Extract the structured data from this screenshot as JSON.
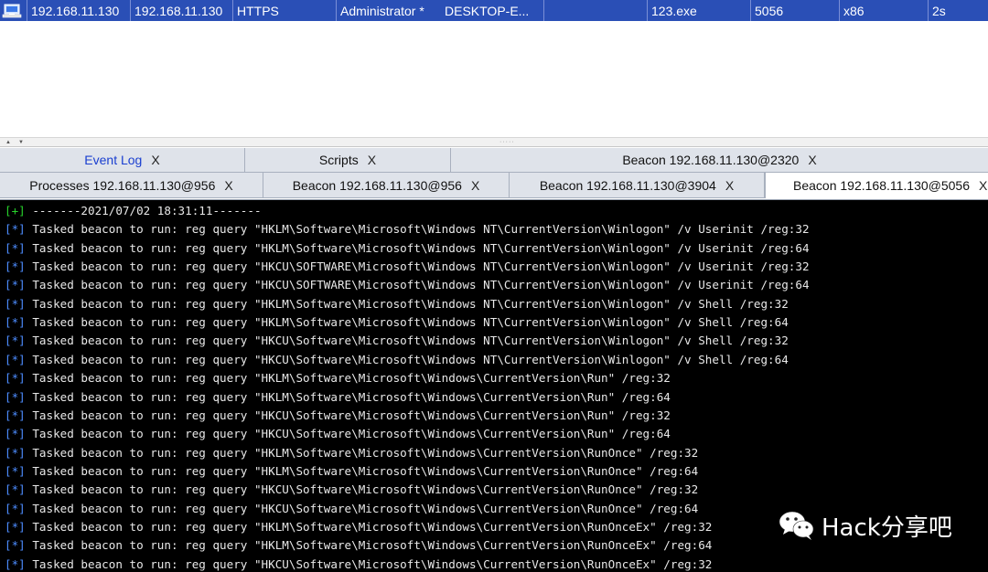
{
  "sessions": {
    "rows": [
      {
        "external": "192.168.11.130",
        "internal": "192.168.11.130",
        "listener": "HTTPS",
        "user": "Administrator *",
        "computer": "DESKTOP-E...",
        "note": "",
        "process": "123.exe",
        "pid": "5056",
        "arch": "x86",
        "last": "2s"
      }
    ],
    "icon": "beacon-computer-icon"
  },
  "splitter": {
    "up": "▲",
    "down": "▼",
    "grip": "·····"
  },
  "tabs_row1": [
    {
      "label": "Event Log",
      "close": "X",
      "active": false
    },
    {
      "label": "Scripts",
      "close": "X",
      "active": false
    },
    {
      "label": "Beacon 192.168.11.130@2320",
      "close": "X",
      "active": false
    }
  ],
  "tabs_row2": [
    {
      "label": "Processes 192.168.11.130@956",
      "close": "X",
      "active": false
    },
    {
      "label": "Beacon 192.168.11.130@956",
      "close": "X",
      "active": false
    },
    {
      "label": "Beacon 192.168.11.130@3904",
      "close": "X",
      "active": false
    },
    {
      "label": "Beacon 192.168.11.130@5056",
      "close": "X",
      "active": true
    }
  ],
  "console": {
    "lines": [
      {
        "prefix": "[+]",
        "text": " -------2021/07/02 18:31:11-------"
      },
      {
        "prefix": "[*]",
        "text": " Tasked beacon to run: reg query \"HKLM\\Software\\Microsoft\\Windows NT\\CurrentVersion\\Winlogon\" /v Userinit /reg:32"
      },
      {
        "prefix": "[*]",
        "text": " Tasked beacon to run: reg query \"HKLM\\Software\\Microsoft\\Windows NT\\CurrentVersion\\Winlogon\" /v Userinit /reg:64"
      },
      {
        "prefix": "[*]",
        "text": " Tasked beacon to run: reg query \"HKCU\\SOFTWARE\\Microsoft\\Windows NT\\CurrentVersion\\Winlogon\" /v Userinit /reg:32"
      },
      {
        "prefix": "[*]",
        "text": " Tasked beacon to run: reg query \"HKCU\\SOFTWARE\\Microsoft\\Windows NT\\CurrentVersion\\Winlogon\" /v Userinit /reg:64"
      },
      {
        "prefix": "[*]",
        "text": " Tasked beacon to run: reg query \"HKLM\\Software\\Microsoft\\Windows NT\\CurrentVersion\\Winlogon\" /v Shell /reg:32"
      },
      {
        "prefix": "[*]",
        "text": " Tasked beacon to run: reg query \"HKLM\\Software\\Microsoft\\Windows NT\\CurrentVersion\\Winlogon\" /v Shell /reg:64"
      },
      {
        "prefix": "[*]",
        "text": " Tasked beacon to run: reg query \"HKCU\\Software\\Microsoft\\Windows NT\\CurrentVersion\\Winlogon\" /v Shell /reg:32"
      },
      {
        "prefix": "[*]",
        "text": " Tasked beacon to run: reg query \"HKCU\\Software\\Microsoft\\Windows NT\\CurrentVersion\\Winlogon\" /v Shell /reg:64"
      },
      {
        "prefix": "[*]",
        "text": " Tasked beacon to run: reg query \"HKLM\\Software\\Microsoft\\Windows\\CurrentVersion\\Run\" /reg:32"
      },
      {
        "prefix": "[*]",
        "text": " Tasked beacon to run: reg query \"HKLM\\Software\\Microsoft\\Windows\\CurrentVersion\\Run\" /reg:64"
      },
      {
        "prefix": "[*]",
        "text": " Tasked beacon to run: reg query \"HKCU\\Software\\Microsoft\\Windows\\CurrentVersion\\Run\" /reg:32"
      },
      {
        "prefix": "[*]",
        "text": " Tasked beacon to run: reg query \"HKCU\\Software\\Microsoft\\Windows\\CurrentVersion\\Run\" /reg:64"
      },
      {
        "prefix": "[*]",
        "text": " Tasked beacon to run: reg query \"HKLM\\Software\\Microsoft\\Windows\\CurrentVersion\\RunOnce\" /reg:32"
      },
      {
        "prefix": "[*]",
        "text": " Tasked beacon to run: reg query \"HKLM\\Software\\Microsoft\\Windows\\CurrentVersion\\RunOnce\" /reg:64"
      },
      {
        "prefix": "[*]",
        "text": " Tasked beacon to run: reg query \"HKCU\\Software\\Microsoft\\Windows\\CurrentVersion\\RunOnce\" /reg:32"
      },
      {
        "prefix": "[*]",
        "text": " Tasked beacon to run: reg query \"HKCU\\Software\\Microsoft\\Windows\\CurrentVersion\\RunOnce\" /reg:64"
      },
      {
        "prefix": "[*]",
        "text": " Tasked beacon to run: reg query \"HKLM\\Software\\Microsoft\\Windows\\CurrentVersion\\RunOnceEx\" /reg:32"
      },
      {
        "prefix": "[*]",
        "text": " Tasked beacon to run: reg query \"HKLM\\Software\\Microsoft\\Windows\\CurrentVersion\\RunOnceEx\" /reg:64"
      },
      {
        "prefix": "[*]",
        "text": " Tasked beacon to run: reg query \"HKCU\\Software\\Microsoft\\Windows\\CurrentVersion\\RunOnceEx\" /reg:32"
      }
    ]
  },
  "watermark": {
    "text": "Hack分享吧",
    "icon": "wechat-icon"
  },
  "colors": {
    "session_row_bg": "#2a4fb6",
    "console_bg": "#000000",
    "console_text": "#e8e8e8",
    "prefix_ok": "#27d22b",
    "prefix_info": "#4d8dff",
    "event_log_link": "#1a3fd0"
  }
}
